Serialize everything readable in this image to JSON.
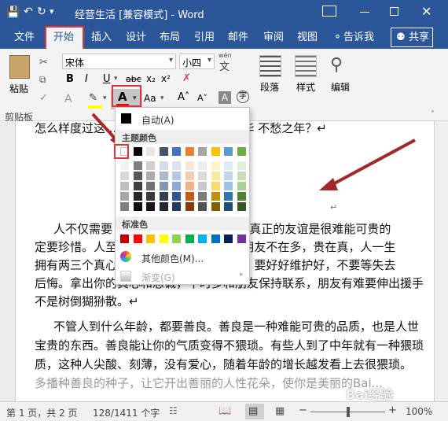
{
  "title": "经营生活 [兼容模式]  -  Word",
  "ribbon_tabs": [
    "文件",
    "开始",
    "插入",
    "设计",
    "布局",
    "引用",
    "邮件",
    "审阅",
    "视图"
  ],
  "tell_me": "告诉我",
  "share": "共享",
  "font_name": "宋体",
  "font_size": "小四",
  "wen_label": "wén",
  "wen_char": "文",
  "paste_label": "粘贴",
  "clipboard_label": "剪贴板",
  "paragraph_label": "段落",
  "styles_label": "样式",
  "edit_label": "编辑",
  "aa_label": "Aa",
  "zi_label": "字",
  "bold": "B",
  "italic": "I",
  "underline": "U",
  "strike": "abc",
  "sub": "x₂",
  "sup": "x²",
  "font_color_letter": "A",
  "dropdown": {
    "auto_label": "自动(A)",
    "theme_label": "主题颜色",
    "standard_label": "标准色",
    "more_label": "其他颜色(M)...",
    "gradient_label": "渐变(G)",
    "theme_top": [
      "#ffffff",
      "#000000",
      "#e7e6e6",
      "#44546a",
      "#4472c4",
      "#ed7d31",
      "#a5a5a5",
      "#ffc000",
      "#5b9bd5",
      "#70ad47"
    ],
    "theme_cols": [
      [
        "#f2f2f2",
        "#d9d9d9",
        "#bfbfbf",
        "#a6a6a6",
        "#808080"
      ],
      [
        "#808080",
        "#595959",
        "#404040",
        "#262626",
        "#0d0d0d"
      ],
      [
        "#d0cece",
        "#aeaaaa",
        "#767171",
        "#3b3838",
        "#171616"
      ],
      [
        "#d6dce5",
        "#adb9ca",
        "#8497b0",
        "#333f50",
        "#222a35"
      ],
      [
        "#d9e2f3",
        "#b4c7e7",
        "#8eaadb",
        "#2f5597",
        "#1f3864"
      ],
      [
        "#fbe5d6",
        "#f8cbad",
        "#f4b183",
        "#c55a11",
        "#843c0c"
      ],
      [
        "#ededed",
        "#dbdbdb",
        "#c9c9c9",
        "#7b7b7b",
        "#525252"
      ],
      [
        "#fff2cc",
        "#ffe699",
        "#ffd966",
        "#bf9000",
        "#7f6000"
      ],
      [
        "#deebf7",
        "#bdd7ee",
        "#9dc3e6",
        "#2e75b6",
        "#1f4e79"
      ],
      [
        "#e2f0d9",
        "#c5e0b4",
        "#a9d18e",
        "#548235",
        "#385723"
      ]
    ],
    "standard": [
      "#c00000",
      "#ff0000",
      "#ffc000",
      "#ffff00",
      "#92d050",
      "#00b050",
      "#00b0f0",
      "#0070c0",
      "#002060",
      "#7030a0"
    ]
  },
  "doc_lines": [
    "怎么样度过这 ...................... 不虚度年华 不愁之年？↵",
    "↵",
    "人不仅需要 ...................... 要友情。真正的友谊是很难能可贵的",
    "定要珍惜。人至 ...................... 用心，朋友不在多，贵在真，人一生",
    "拥有两三个真心 ...................... 运的事。要好好维护好，不要等失去",
    "后悔。拿出你的真心和忠诚，平时多和朋友保持联系，朋友有难要伸出援手",
    "不是树倒猢狲散。↵",
    "不管人到什么年龄，都要善良。善良是一种难能可贵的品质，也是人世",
    "宝贵的东西。善良能让你的气质变得不猥琐。有些人到了中年就有一种猥琐",
    "质，这种人尖酸、刻薄，没有爱心，随着年龄的增长越发看上去很猥琐。",
    "多播种善良的种子，让它开出善丽的人性花朵，使你是美丽的Bai..."
  ],
  "status": {
    "page": "第 1 页，共 2 页",
    "words": "128/1411 个字",
    "zoom": "100%",
    "minus": "−",
    "plus": "+"
  },
  "watermark": "Bai经验"
}
